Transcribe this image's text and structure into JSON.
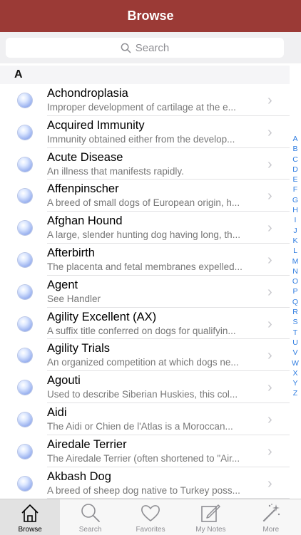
{
  "navbar": {
    "title": "Browse"
  },
  "search": {
    "placeholder": "Search"
  },
  "section": {
    "header": "A"
  },
  "rows": [
    {
      "title": "Achondroplasia",
      "subtitle": "Improper development of cartilage at the e..."
    },
    {
      "title": "Acquired Immunity",
      "subtitle": "Immunity obtained either from the develop..."
    },
    {
      "title": "Acute Disease",
      "subtitle": "An illness that manifests rapidly."
    },
    {
      "title": "Affenpinscher",
      "subtitle": "A breed of small dogs of European origin, h..."
    },
    {
      "title": "Afghan Hound",
      "subtitle": "A large, slender hunting dog having long, th..."
    },
    {
      "title": "Afterbirth",
      "subtitle": "The placenta and fetal membranes expelled..."
    },
    {
      "title": "Agent",
      "subtitle": "See Handler"
    },
    {
      "title": "Agility Excellent (AX)",
      "subtitle": "A suffix title conferred on dogs for qualifyin..."
    },
    {
      "title": "Agility Trials",
      "subtitle": "An organized competition at which dogs ne..."
    },
    {
      "title": "Agouti",
      "subtitle": "Used to describe Siberian Huskies, this col..."
    },
    {
      "title": "Aidi",
      "subtitle": "The Aidi or Chien de l'Atlas is a Moroccan..."
    },
    {
      "title": "Airedale Terrier",
      "subtitle": "The Airedale Terrier (often shortened to \"Air..."
    },
    {
      "title": "Akbash Dog",
      "subtitle": "A breed of sheep dog native to Turkey poss..."
    }
  ],
  "index_letters": [
    "A",
    "B",
    "C",
    "D",
    "E",
    "F",
    "G",
    "H",
    "I",
    "J",
    "K",
    "L",
    "M",
    "N",
    "O",
    "P",
    "Q",
    "R",
    "S",
    "T",
    "U",
    "V",
    "W",
    "X",
    "Y",
    "Z"
  ],
  "tabs": [
    {
      "label": "Browse",
      "icon": "home-icon",
      "active": true
    },
    {
      "label": "Search",
      "icon": "magnifier-icon",
      "active": false
    },
    {
      "label": "Favorites",
      "icon": "heart-icon",
      "active": false
    },
    {
      "label": "My Notes",
      "icon": "note-icon",
      "active": false
    },
    {
      "label": "More",
      "icon": "magic-wand-icon",
      "active": false
    }
  ],
  "colors": {
    "navbar": "#9b3a36",
    "index": "#2f7de1"
  }
}
